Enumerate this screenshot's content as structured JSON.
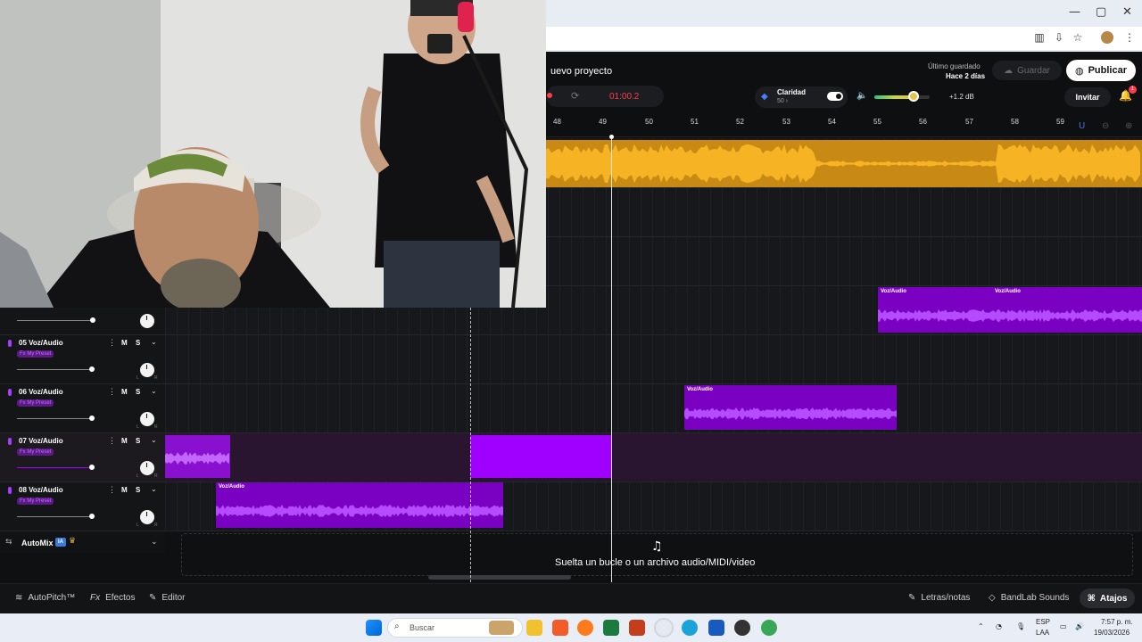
{
  "browser": {
    "window_controls": [
      "—",
      "▢",
      "✕"
    ],
    "toolbar_icons": [
      "sidebar-icon",
      "install-icon",
      "star-icon",
      "profile-avatar",
      "kebab-menu-icon"
    ]
  },
  "header": {
    "project_title": "uevo proyecto",
    "last_saved_label": "Último guardado",
    "last_saved_time": "Hace 2 días",
    "save_label": "Guardar",
    "publish_label": "Publicar",
    "invite_label": "Invitar",
    "notification_count": "1"
  },
  "transport": {
    "time": "01:00.2",
    "clarity_label": "Claridad",
    "clarity_value": "50 ›",
    "clarity_on": true,
    "volume_level": 0.72,
    "volume_db": "+1.2 dB"
  },
  "ruler": {
    "bars": [
      "48",
      "49",
      "50",
      "51",
      "52",
      "53",
      "54",
      "55",
      "56",
      "57",
      "58",
      "59"
    ]
  },
  "tracks": [
    {
      "num": "05",
      "name": "05  Voz/Audio",
      "fx": "Fx  My Preset",
      "mute": "M",
      "solo": "S",
      "fader": 0.7
    },
    {
      "num": "06",
      "name": "06  Voz/Audio",
      "fx": "Fx  My Preset",
      "mute": "M",
      "solo": "S",
      "fader": 0.7
    },
    {
      "num": "07",
      "name": "07  Voz/Audio",
      "fx": "Fx  My Preset",
      "mute": "M",
      "solo": "S",
      "fader": 0.7
    },
    {
      "num": "08",
      "name": "08  Voz/Audio",
      "fx": "Fx  My Preset",
      "mute": "M",
      "solo": "S",
      "fader": 0.7
    }
  ],
  "clips": {
    "label": "Voz/Audio"
  },
  "automix": {
    "label": "AutoMix",
    "badge": "IA"
  },
  "dropzone": {
    "text": "Suelta un bucle o un archivo audio/MIDI/video"
  },
  "bottombar": {
    "autopitch": "AutoPitch™",
    "effects": "Efectos",
    "editor": "Editor",
    "lyrics": "Letras/notas",
    "sounds": "BandLab Sounds",
    "shortcuts": "Atajos"
  },
  "taskbar": {
    "search_placeholder": "Buscar",
    "lang_top": "ESP",
    "lang_bottom": "LAA",
    "time": "7:57 p. m.",
    "date": "19/03/2026"
  },
  "colors": {
    "accent_orange": "#f4a91f",
    "accent_purple": "#a000ff",
    "record_red": "#ff3b4a"
  }
}
